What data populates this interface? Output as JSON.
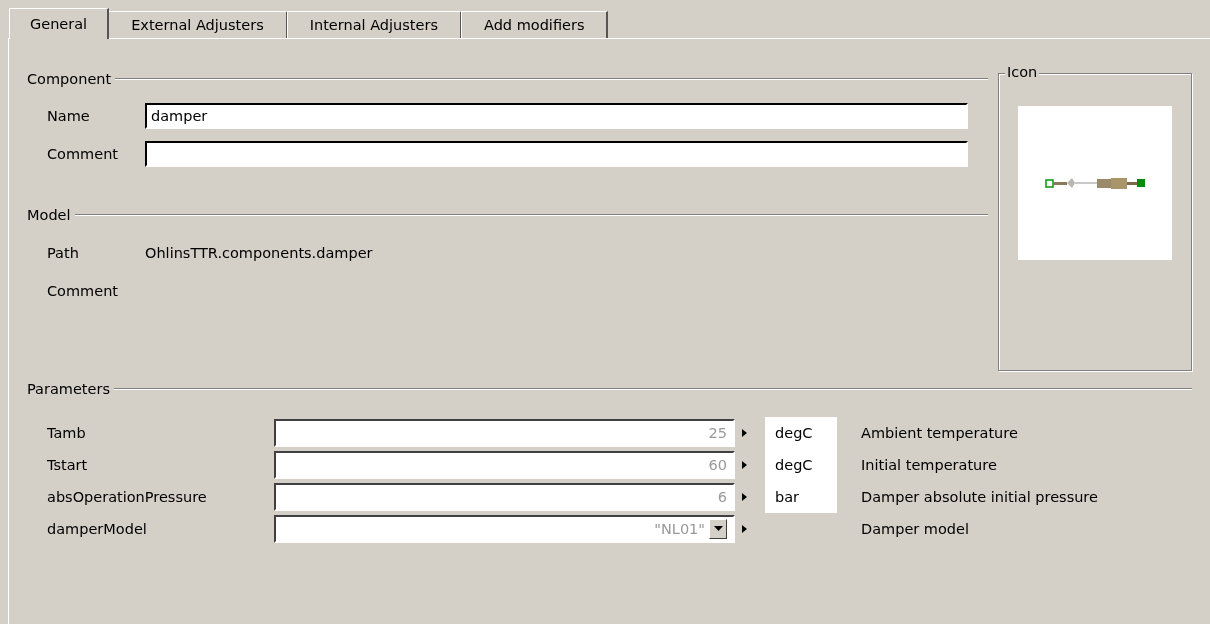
{
  "tabs": [
    {
      "label": "General",
      "selected": true
    },
    {
      "label": "External Adjusters",
      "selected": false
    },
    {
      "label": "Internal Adjusters",
      "selected": false
    },
    {
      "label": "Add modifiers",
      "selected": false
    }
  ],
  "component": {
    "title": "Component",
    "name_label": "Name",
    "name_value": "damper",
    "comment_label": "Comment"
  },
  "model": {
    "title": "Model",
    "path_label": "Path",
    "path_value": "OhlinsTTR.components.damper",
    "comment_label": "Comment"
  },
  "icon": {
    "title": "Icon"
  },
  "parameters": {
    "title": "Parameters",
    "rows": [
      {
        "name": "Tamb",
        "kind": "number",
        "value": "25",
        "unit": "degC",
        "description": "Ambient temperature"
      },
      {
        "name": "Tstart",
        "kind": "number",
        "value": "60",
        "unit": "degC",
        "description": "Initial temperature"
      },
      {
        "name": "absOperationPressure",
        "kind": "number",
        "value": "6",
        "unit": "bar",
        "description": "Damper absolute initial pressure"
      },
      {
        "name": "damperModel",
        "kind": "choice",
        "value": "\"NL01\"",
        "description": "Damper model"
      }
    ]
  }
}
